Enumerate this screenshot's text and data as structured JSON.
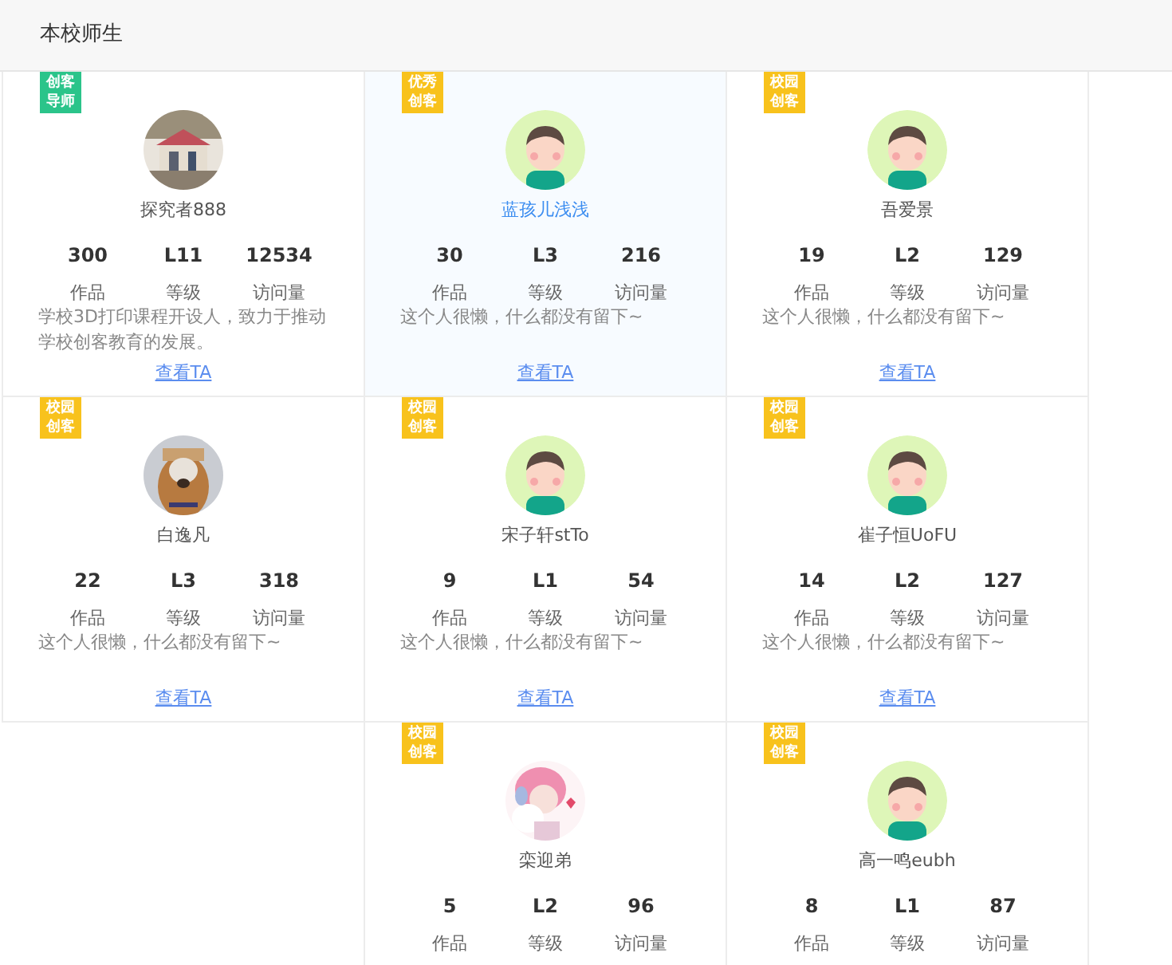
{
  "header": {
    "title": "本校师生"
  },
  "cards": [
    {
      "badge": {
        "text": "创客导师",
        "color": "#2bc48a"
      },
      "name": "探究者888",
      "selected": false,
      "stats": [
        {
          "value": "300",
          "label": "作品"
        },
        {
          "value": "L11",
          "label": "等级"
        },
        {
          "value": "12534",
          "label": "访问量"
        }
      ],
      "bio": "学校3D打印课程开设人，致力于推动学校创客教育的发展。",
      "link": "查看TA"
    },
    {
      "badge": {
        "text": "优秀创客",
        "color": "#f8c21c"
      },
      "avatar": {
        "kind": "default"
      },
      "name": "蓝孩儿浅浅",
      "selected": true,
      "stats": [
        {
          "value": "30",
          "label": "作品"
        },
        {
          "value": "L3",
          "label": "等级"
        },
        {
          "value": "216",
          "label": "访问量"
        }
      ],
      "bio": "这个人很懒，什么都没有留下~",
      "link": "查看TA"
    },
    {
      "badge": {
        "text": "校园创客",
        "color": "#f8c21c"
      },
      "avatar": {
        "kind": "default"
      },
      "name": "吾爱景",
      "selected": false,
      "stats": [
        {
          "value": "19",
          "label": "作品"
        },
        {
          "value": "L2",
          "label": "等级"
        },
        {
          "value": "129",
          "label": "访问量"
        }
      ],
      "bio": "这个人很懒，什么都没有留下~",
      "link": "查看TA"
    },
    {
      "badge": {
        "text": "校园创客",
        "color": "#f8c21c"
      },
      "name": "白逸凡",
      "selected": false,
      "stats": [
        {
          "value": "22",
          "label": "作品"
        },
        {
          "value": "L3",
          "label": "等级"
        },
        {
          "value": "318",
          "label": "访问量"
        }
      ],
      "bio": "这个人很懒，什么都没有留下~",
      "link": "查看TA"
    },
    {
      "badge": {
        "text": "校园创客",
        "color": "#f8c21c"
      },
      "avatar": {
        "kind": "default"
      },
      "name": "宋子轩stTo",
      "selected": false,
      "stats": [
        {
          "value": "9",
          "label": "作品"
        },
        {
          "value": "L1",
          "label": "等级"
        },
        {
          "value": "54",
          "label": "访问量"
        }
      ],
      "bio": "这个人很懒，什么都没有留下~",
      "link": "查看TA"
    },
    {
      "badge": {
        "text": "校园创客",
        "color": "#f8c21c"
      },
      "avatar": {
        "kind": "default"
      },
      "name": "崔子恒UoFU",
      "selected": false,
      "stats": [
        {
          "value": "14",
          "label": "作品"
        },
        {
          "value": "L2",
          "label": "等级"
        },
        {
          "value": "127",
          "label": "访问量"
        }
      ],
      "bio": "这个人很懒，什么都没有留下~",
      "link": "查看TA"
    },
    {
      "badge": {
        "text": "校园创客",
        "color": "#f8c21c"
      },
      "name": "栾迎弟",
      "selected": false,
      "stats": [
        {
          "value": "5",
          "label": "作品"
        },
        {
          "value": "L2",
          "label": "等级"
        },
        {
          "value": "96",
          "label": "访问量"
        }
      ]
    },
    {
      "badge": {
        "text": "校园创客",
        "color": "#f8c21c"
      },
      "avatar": {
        "kind": "default"
      },
      "name": "高一鸣eubh",
      "selected": false,
      "stats": [
        {
          "value": "8",
          "label": "作品"
        },
        {
          "value": "L1",
          "label": "等级"
        },
        {
          "value": "87",
          "label": "访问量"
        }
      ]
    }
  ]
}
